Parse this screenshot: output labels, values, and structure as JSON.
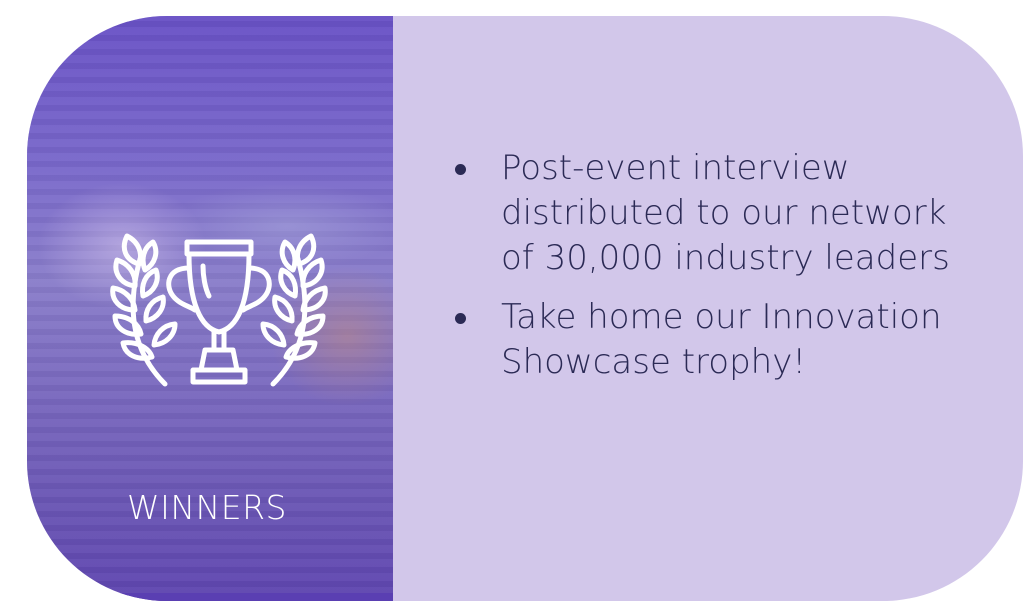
{
  "panel": {
    "icon": "trophy-with-laurel-wreath-icon",
    "label": "WINNERS"
  },
  "benefits": [
    {
      "text": "Post-event interview distributed to our network of 30,000 industry leaders"
    },
    {
      "text": "Take home our Innovation Showcase trophy!"
    }
  ],
  "colors": {
    "card_background": "#d2c7ea",
    "panel_purple": "#6a53c7",
    "text": "#2b2a55",
    "icon": "#ffffff"
  }
}
